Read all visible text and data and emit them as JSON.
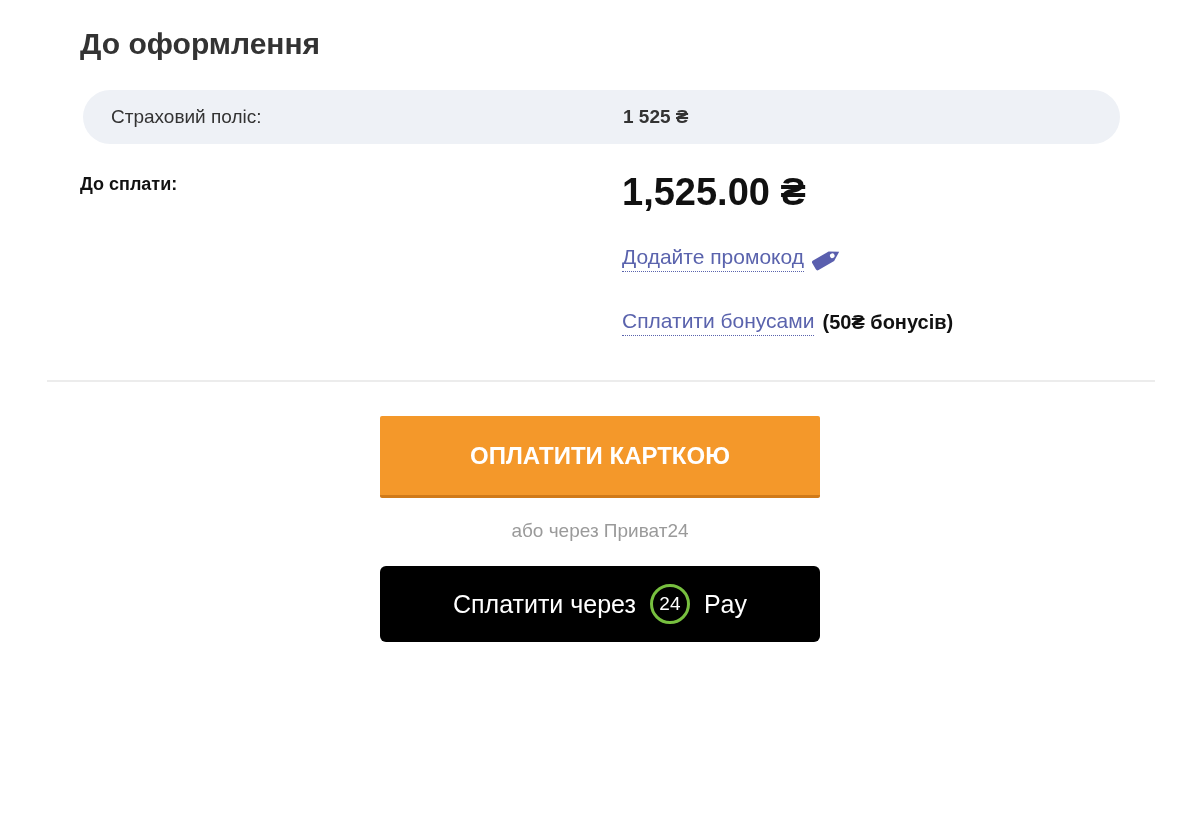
{
  "heading": "До оформлення",
  "summary_rows": [
    {
      "label": "Страховий поліс:",
      "value": "1 525 ₴"
    }
  ],
  "total": {
    "label": "До сплати:",
    "amount": "1,525.00 ₴"
  },
  "actions": [
    {
      "kind": "promo",
      "link": "Додайте промокод"
    },
    {
      "kind": "bonus",
      "link": "Сплатити бонусами",
      "note": "(50₴ бонусів)"
    }
  ],
  "card_button": {
    "label": "ОПЛАТИТИ КАРТКОЮ"
  },
  "alternative_text": "або через Приват24",
  "wallet_button": {
    "label": "Сплатити через",
    "badge": "24",
    "suffix": "Pay"
  }
}
